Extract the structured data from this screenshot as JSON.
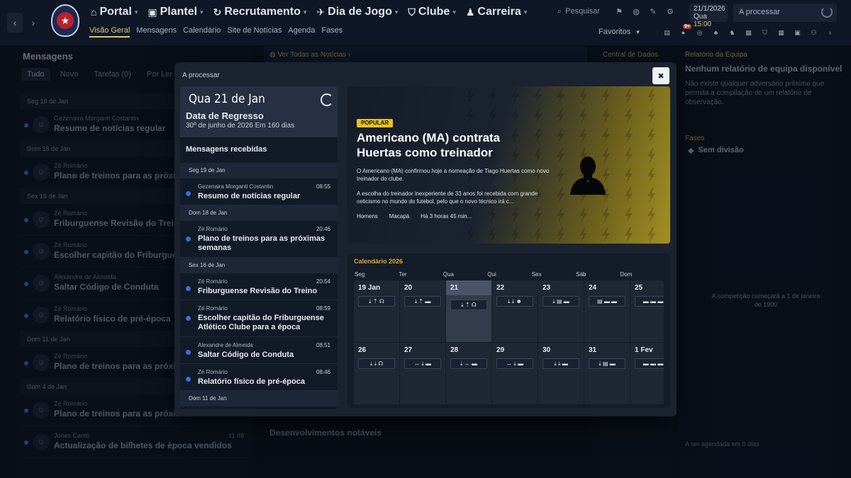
{
  "topnav": {
    "items": [
      {
        "label": "Portal",
        "icon": "home-icon",
        "glyph": "⌂"
      },
      {
        "label": "Plantel",
        "icon": "shirt-icon",
        "glyph": "👕"
      },
      {
        "label": "Recrutamento",
        "icon": "refresh-icon",
        "glyph": "↻"
      },
      {
        "label": "Dia de Jogo",
        "icon": "whistle-icon",
        "glyph": "✈"
      },
      {
        "label": "Clube",
        "icon": "shield-icon",
        "glyph": "⛉"
      },
      {
        "label": "Carreira",
        "icon": "user-icon",
        "glyph": "👤"
      }
    ],
    "subnav": [
      "Visão Geral",
      "Mensagens",
      "Calendário",
      "Site de Notícias",
      "Agenda",
      "Fases"
    ],
    "search_label": "Pesquisar",
    "date": "21/1/2026",
    "day": "Qua",
    "time": "15:00",
    "processing": "A processar",
    "favorites": "Favoritos",
    "notif_badge": "9+"
  },
  "left_panel": {
    "title": "Mensagens",
    "tabs": [
      "Tudo",
      "Novo",
      "Tarefas (0)",
      "Por Ler (30)"
    ],
    "groups": [
      {
        "date": "Seg 19 de Jan",
        "msgs": [
          {
            "from": "Gezenaira Morganti Costantin",
            "subject": "Resumo de notícias regular",
            "time": ""
          }
        ]
      },
      {
        "date": "Dom 18 de Jan",
        "msgs": [
          {
            "from": "Zé Romário",
            "subject": "Plano de treinos para as próximas",
            "time": ""
          }
        ]
      },
      {
        "date": "Sex 16 de Jan",
        "msgs": [
          {
            "from": "Zé Romário",
            "subject": "Friburguense Revisão do Treino",
            "time": ""
          },
          {
            "from": "Zé Romário",
            "subject": "Escolher capitão do Friburguense",
            "time": ""
          },
          {
            "from": "Alexandre de Almeida",
            "subject": "Saltar Código de Conduta",
            "time": ""
          },
          {
            "from": "Zé Romário",
            "subject": "Relatório físico de pré-época",
            "time": ""
          }
        ]
      },
      {
        "date": "Dom 11 de Jan",
        "msgs": [
          {
            "from": "Zé Romário",
            "subject": "Plano de treinos para as próximas",
            "time": ""
          }
        ]
      },
      {
        "date": "Dom 4 de Jan",
        "msgs": [
          {
            "from": "Zé Romário",
            "subject": "Plano de treinos para as próximas semanas",
            "time": ""
          },
          {
            "from": "Jones Canto",
            "subject": "Actualização de bilhetes de época vendidos",
            "time": "11:48"
          }
        ]
      }
    ]
  },
  "center": {
    "news_link": "Ver Todas as Notícias",
    "developments": "Desenvolvimentos notáveis"
  },
  "central_panel": {
    "title": "Central de Dados"
  },
  "right_panel": {
    "section1": "Relatório da Equipa",
    "heading": "Nenhum relatório de equipa disponível",
    "desc": "Não existe qualquer adversário próximo que permita a compilação de um relatório de observação.",
    "section2": "Fases",
    "fase": "Sem divisão",
    "note": "A competição começará a 1 de janeiro de 1900",
    "scheduled": "A ser agendada em 0 dias"
  },
  "modal": {
    "title": "A processar",
    "close_label": "✖",
    "current_date": "Qua 21 de Jan",
    "return_title": "Data de Regresso",
    "return_date": "30º de junho de 2026  Em 160 dias",
    "received_title": "Mensagens recebidas",
    "groups": [
      {
        "date": "Seg 19 de Jan",
        "msgs": [
          {
            "from": "Gezenaira Morganti Costantin",
            "subject": "Resumo de notícias regular",
            "time": "08:55"
          }
        ]
      },
      {
        "date": "Dom 18 de Jan",
        "msgs": [
          {
            "from": "Zé Romário",
            "subject": "Plano de treinos para as próximas semanas",
            "time": "20:46"
          }
        ]
      },
      {
        "date": "Sex 16 de Jan",
        "msgs": [
          {
            "from": "Zé Romário",
            "subject": "Friburguense Revisão do Treino",
            "time": "20:54"
          },
          {
            "from": "Zé Romário",
            "subject": "Escolher capitão do Friburguense Atlético Clube para a época",
            "time": "08:59"
          },
          {
            "from": "Alexandre de Almeida",
            "subject": "Saltar Código de Conduta",
            "time": "08:51"
          },
          {
            "from": "Zé Romário",
            "subject": "Relatório físico de pré-época",
            "time": "08:46"
          }
        ]
      },
      {
        "date": "Dom 11 de Jan",
        "msgs": []
      }
    ],
    "news": {
      "badge": "POPULAR",
      "headline": "Americano (MA) contrata Huertas como treinador",
      "body1": "O Americano (MA) confirmou hoje a nomeação de Tiago Huertas como novo treinador do clube.",
      "body2": "A escolha do treinador inexperiente de 33 anos foi recebida com grande ceticismo no mundo do futebol, pelo que o novo técnico irá c...",
      "tags": [
        "Homens",
        "Macapá",
        "Há 3 horas 45 min..."
      ]
    },
    "calendar": {
      "title": "Calendário 2026",
      "weekdays": [
        "Seg",
        "Ter",
        "Qua",
        "Qui",
        "Sex",
        "Sáb",
        "Dom"
      ],
      "cells": [
        {
          "num": "19 Jan",
          "events": "⤓ ⇡ ☊"
        },
        {
          "num": "20",
          "events": "⤓ ⇡ ▬"
        },
        {
          "num": "21",
          "events": "⤓ ⇡ ☊",
          "today": true
        },
        {
          "num": "22",
          "events": "⤓ ⤓ ☻"
        },
        {
          "num": "23",
          "events": "⤓ ▤ ▬"
        },
        {
          "num": "24",
          "events": "▤ ▬ ▬"
        },
        {
          "num": "25",
          "events": "▬ ▬ ▬"
        },
        {
          "num": "26",
          "events": "⤓ ⤓ ☊"
        },
        {
          "num": "27",
          "events": "↔ ⤓ ▬"
        },
        {
          "num": "28",
          "events": "⤓ ↔ ▬"
        },
        {
          "num": "29",
          "events": "↔ ⤓ ▬"
        },
        {
          "num": "30",
          "events": "⤓ ⤓ ▬"
        },
        {
          "num": "31",
          "events": "⤓ ▤ ▬"
        },
        {
          "num": "1 Fev",
          "events": "▬ ▬ ▬"
        }
      ]
    }
  }
}
